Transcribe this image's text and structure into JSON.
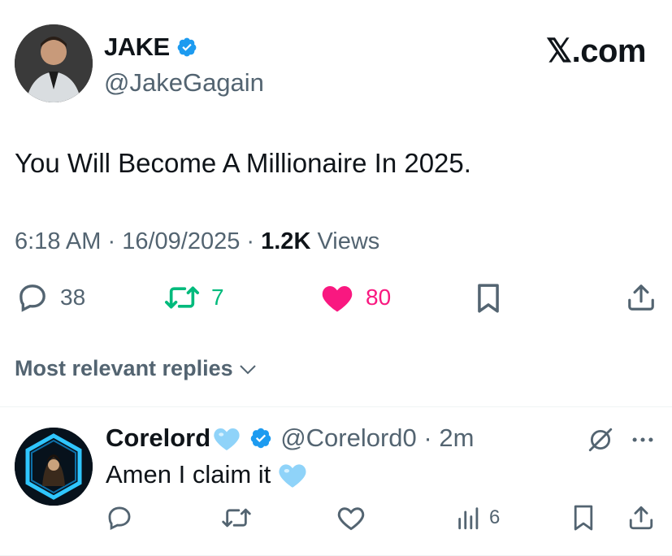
{
  "author": {
    "name": "JAKE",
    "handle": "@JakeGagain"
  },
  "brand": "𝕏.com",
  "tweet": {
    "text": "You Will Become A Millionaire In 2025.",
    "time": "6:18 AM",
    "date": "16/09/2025",
    "views_count": "1.2K",
    "views_label": "Views"
  },
  "actions": {
    "replies": "38",
    "reposts": "7",
    "likes": "80"
  },
  "replies_header": "Most relevant replies",
  "reply": {
    "name": "Corelord",
    "handle": "@Corelord0",
    "time": "2m",
    "text": "Amen I claim it",
    "views": "6"
  },
  "colors": {
    "accent_blue": "#1d9bf0",
    "repost_green": "#00ba7c",
    "like_pink": "#f91880",
    "muted": "#536471"
  }
}
